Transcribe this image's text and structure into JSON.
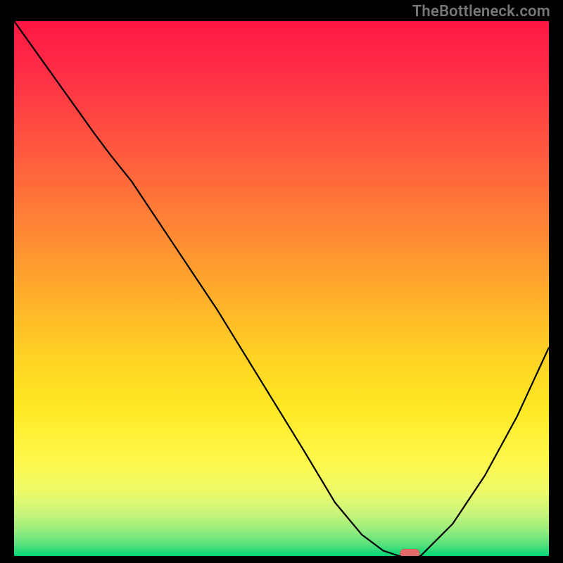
{
  "attribution": "TheBottleneck.com",
  "colors": {
    "frame": "#000000",
    "curve": "#000000",
    "marker": "#e46a6a",
    "gradient_top": "#ff1744",
    "gradient_bottom": "#00d676"
  },
  "chart_data": {
    "type": "line",
    "title": "",
    "xlabel": "",
    "ylabel": "",
    "x": [
      0.0,
      0.05,
      0.1,
      0.15,
      0.18,
      0.22,
      0.3,
      0.38,
      0.46,
      0.54,
      0.6,
      0.65,
      0.69,
      0.72,
      0.76,
      0.82,
      0.88,
      0.94,
      1.0
    ],
    "y": [
      1.0,
      0.93,
      0.86,
      0.79,
      0.75,
      0.7,
      0.58,
      0.46,
      0.33,
      0.2,
      0.1,
      0.04,
      0.01,
      0.0,
      0.0,
      0.06,
      0.15,
      0.26,
      0.39
    ],
    "xlim": [
      0,
      1
    ],
    "ylim": [
      0,
      1
    ],
    "marker": {
      "x": 0.74,
      "y": 0.005,
      "shape": "pill"
    },
    "legend": false,
    "grid": false
  }
}
